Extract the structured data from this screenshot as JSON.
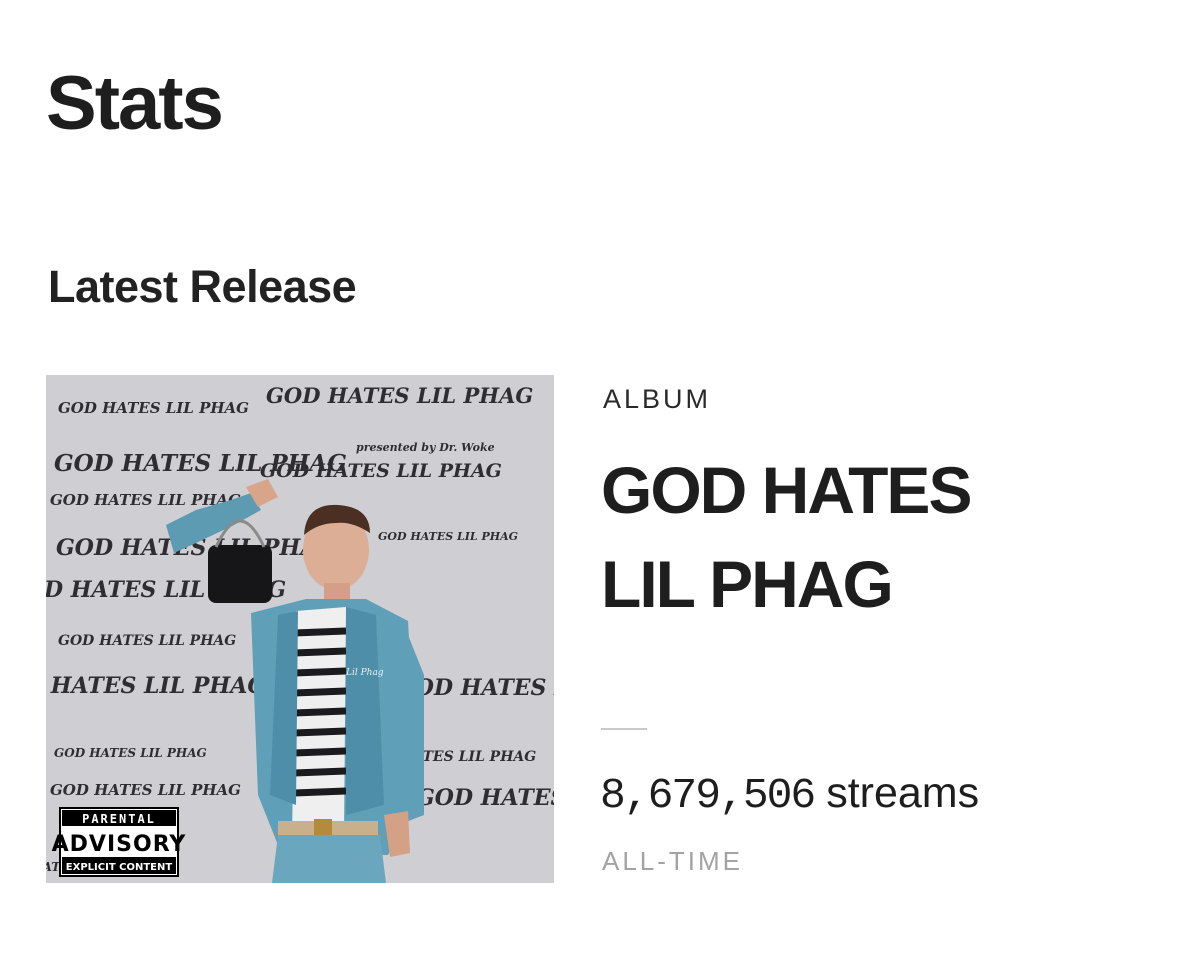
{
  "page": {
    "title": "Stats"
  },
  "latest_release": {
    "section_title": "Latest Release",
    "cover": {
      "title_text": "GOD HATES LIL PHAG",
      "credit_text": "presented by Dr. Woke",
      "advisory": {
        "line1": "PARENTAL",
        "line2": "ADVISORY",
        "line3": "EXPLICIT CONTENT"
      },
      "jacket_tag": "Lil Phag",
      "background_color": "#cfced3",
      "text_color": "#2d2d32"
    },
    "type_label": "ALBUM",
    "name_line1": "GOD HATES",
    "name_line2": "LIL PHAG",
    "stream_count": "8,679,506",
    "stream_unit": "streams",
    "period_label": "ALL-TIME"
  }
}
